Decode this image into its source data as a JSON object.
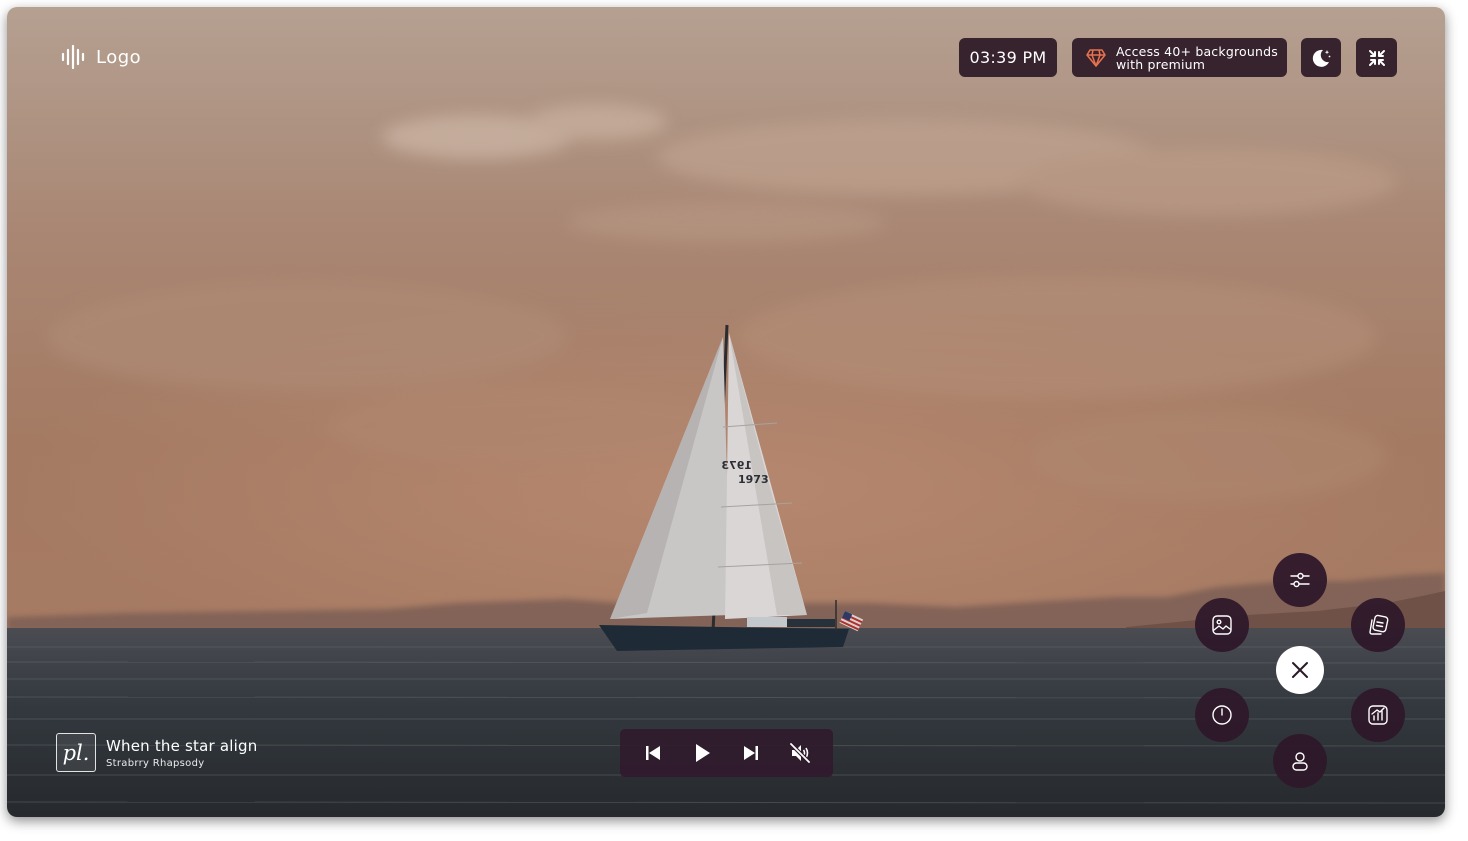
{
  "header": {
    "logo_label": "Logo",
    "clock": "03:39 PM",
    "premium": {
      "line1": "Access 40+ backgrounds",
      "line2": "with premium"
    },
    "icons": [
      "sound-wave-icon",
      "gem-icon",
      "moon-stars-icon",
      "collapse-icon"
    ]
  },
  "now_playing": {
    "art_text": "pl.",
    "title": "When the star align",
    "artist": "Strabrry Rhapsody"
  },
  "player": {
    "controls": [
      "previous-icon",
      "play-icon",
      "next-icon",
      "volume-muted-icon"
    ]
  },
  "quick_menu": {
    "items": [
      "sliders-icon",
      "image-frame-icon",
      "notes-icon",
      "timer-icon",
      "chart-icon",
      "user-icon",
      "close-icon"
    ]
  },
  "scene": {
    "sail_number": "1973"
  },
  "colors": {
    "panel": "#2c1925",
    "player": "#301a2c",
    "accent_gem": "#e8734e",
    "sky_top": "#b9a393",
    "water": "#2c3338"
  }
}
